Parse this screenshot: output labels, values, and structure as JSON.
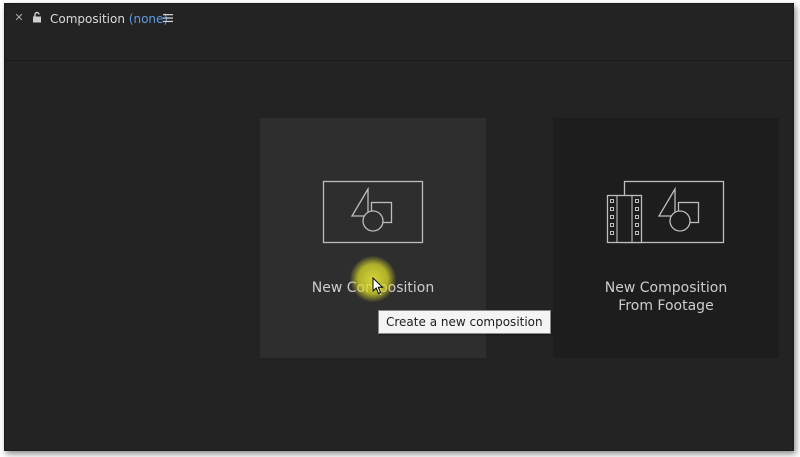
{
  "tab": {
    "name": "Composition",
    "comp_name": "(none)",
    "close_icon": "close-icon",
    "lock_icon": "lock-icon",
    "menu_icon": "hamburger-menu-icon"
  },
  "cards": {
    "new_composition": {
      "label": "New Composition",
      "icon": "composition-shapes-icon"
    },
    "new_from_footage": {
      "label_line1": "New Composition",
      "label_line2": "From Footage",
      "icon": "footage-composition-icon"
    }
  },
  "tooltip": {
    "text": "Create a new composition"
  },
  "colors": {
    "panel_bg": "#232323",
    "card_hover_bg": "#2e2e2e",
    "card_bg": "#1d1d1d",
    "comp_name_accent": "#5d9be3",
    "icon_stroke": "#bdbdbd"
  }
}
